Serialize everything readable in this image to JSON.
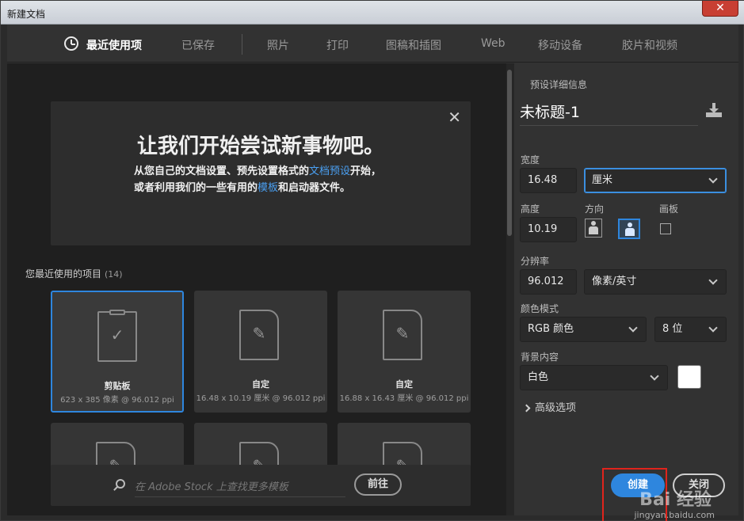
{
  "window": {
    "title": "新建文档",
    "close_glyph": "✕"
  },
  "tabs": [
    {
      "label": "最近使用项",
      "icon": "clock-icon",
      "active": true
    },
    {
      "label": "已保存"
    },
    {
      "label": "照片"
    },
    {
      "label": "打印"
    },
    {
      "label": "图稿和插图"
    },
    {
      "label": "Web"
    },
    {
      "label": "移动设备"
    },
    {
      "label": "胶片和视频"
    }
  ],
  "welcome": {
    "close_glyph": "✕",
    "headline": "让我们开始尝试新事物吧。",
    "desc_parts": [
      "从您自己的文档设置、预先设置格式的",
      "文档预设",
      "开始，或者利用我们的一些有用的",
      "模板",
      "和启动器文件。"
    ]
  },
  "recent": {
    "title": "您最近使用的项目",
    "count": "(14)",
    "items": [
      {
        "name": "剪贴板",
        "meta": "623 x 385 像素 @ 96.012 ppi",
        "icon": "clipboard-icon",
        "selected": true
      },
      {
        "name": "自定",
        "meta": "16.48 x 10.19 厘米 @ 96.012 ppi",
        "icon": "document-pencil-icon"
      },
      {
        "name": "自定",
        "meta": "16.88 x 16.43 厘米 @ 96.012 ppi",
        "icon": "document-pencil-icon"
      },
      {
        "name": "",
        "meta": "",
        "icon": "document-pencil-icon"
      },
      {
        "name": "",
        "meta": "",
        "icon": "document-pencil-icon"
      },
      {
        "name": "",
        "meta": "",
        "icon": "document-pencil-icon"
      }
    ]
  },
  "search": {
    "placeholder": "在 Adobe Stock 上查找更多模板",
    "go_label": "前往"
  },
  "preset": {
    "section_title": "预设详细信息",
    "doc_name": "未标题-1",
    "width_label": "宽度",
    "width_value": "16.48",
    "width_unit": "厘米",
    "height_label": "高度",
    "height_value": "10.19",
    "orientation_label": "方向",
    "artboard_label": "画板",
    "resolution_label": "分辨率",
    "resolution_value": "96.012",
    "resolution_unit": "像素/英寸",
    "color_mode_label": "颜色模式",
    "color_mode_value": "RGB 颜色",
    "bit_depth_value": "8 位",
    "background_label": "背景内容",
    "background_value": "白色",
    "background_color": "#ffffff",
    "advanced_label": "高级选项",
    "create_label": "创建",
    "close_label": "关闭"
  },
  "watermark": {
    "text": "Bai 经验",
    "url": "jingyan.baidu.com"
  },
  "colors": {
    "accent": "#2e86de",
    "link": "#4aa0f3",
    "highlight": "#e0241c"
  }
}
